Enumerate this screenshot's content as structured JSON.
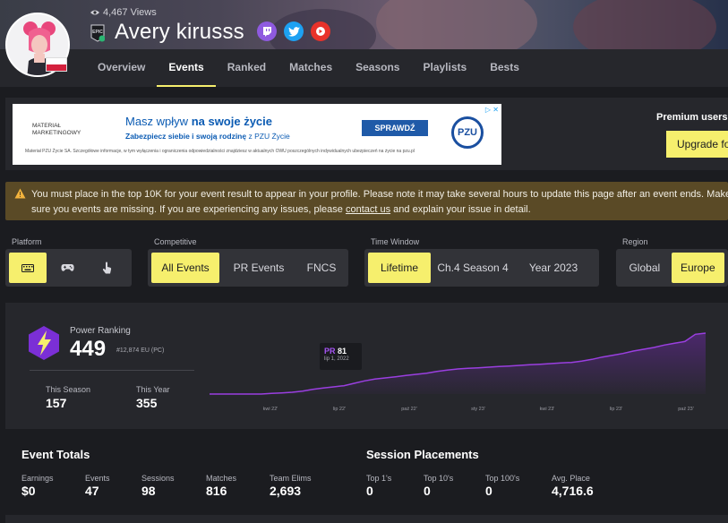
{
  "profile": {
    "views": "4,467 Views",
    "name": "Avery kirusss",
    "platform_badge": "EPIC"
  },
  "tabs": [
    {
      "label": "Overview"
    },
    {
      "label": "Events"
    },
    {
      "label": "Ranked"
    },
    {
      "label": "Matches"
    },
    {
      "label": "Seasons"
    },
    {
      "label": "Playlists"
    },
    {
      "label": "Bests"
    }
  ],
  "ad": {
    "small_label": "MATERIAŁ MARKETINGOWY",
    "headline_1": "Masz wpływ ",
    "headline_2": "na swoje życie",
    "subline_1": "Zabezpiecz siebie i swoją rodzinę",
    "subline_2": " z PZU Życie",
    "cta": "SPRAWDŹ",
    "brand": "PZU",
    "fineprint": "Materiał PZU Życie SA. Szczegółowe informacje, w tym wyłączenia i ograniczenia odpowiedzialności znajdziesz w aktualnych OWU poszczególnych indywidualnych ubezpieczeń na życie na pzu.pl"
  },
  "premium": {
    "text": "Premium users g",
    "button": "Upgrade fo"
  },
  "warning": {
    "text_before": "You must place in the top 10K for your event result to appear in your profile. Please note it may take several hours to update this page after an event ends. Make sure you events are missing. If you are experiencing any issues, please ",
    "link": "contact us",
    "text_after": " and explain your issue in detail."
  },
  "filters": {
    "platform_label": "Platform",
    "competitive_label": "Competitive",
    "competitive_options": [
      "All Events",
      "PR Events",
      "FNCS"
    ],
    "time_label": "Time Window",
    "time_options": [
      "Lifetime",
      "Ch.4 Season 4",
      "Year 2023"
    ],
    "region_label": "Region",
    "region_options": [
      "Global",
      "Europe"
    ]
  },
  "power_ranking": {
    "label": "Power Ranking",
    "value": "449",
    "sub": "#12,874 EU (PC)",
    "this_season_label": "This Season",
    "this_season_value": "157",
    "this_year_label": "This Year",
    "this_year_value": "355",
    "tooltip_prefix": "PR",
    "tooltip_value": "81",
    "tooltip_date": "lip 1, 2022"
  },
  "chart_data": {
    "type": "area",
    "x_ticks": [
      "kwi 22'",
      "lip 22'",
      "paź 22'",
      "sty 23'",
      "kwi 23'",
      "lip 23'",
      "paź 23'"
    ],
    "series": [
      {
        "values": [
          0,
          0,
          0,
          0,
          0,
          0,
          1,
          2,
          3,
          5,
          8,
          10,
          12,
          14,
          18,
          22,
          25,
          27,
          29,
          31,
          33,
          35,
          38,
          40,
          42,
          43,
          44,
          45,
          46,
          47,
          48,
          49,
          50,
          51,
          52,
          53,
          55,
          58,
          62,
          65,
          68,
          72,
          75,
          78,
          82,
          85,
          88,
          100,
          102
        ]
      }
    ],
    "color": "#9a3fe0"
  },
  "event_totals": {
    "title": "Event Totals",
    "stats": [
      {
        "label": "Earnings",
        "value": "$0"
      },
      {
        "label": "Events",
        "value": "47"
      },
      {
        "label": "Sessions",
        "value": "98"
      },
      {
        "label": "Matches",
        "value": "816"
      },
      {
        "label": "Team Elims",
        "value": "2,693"
      }
    ]
  },
  "session_placements": {
    "title": "Session Placements",
    "stats": [
      {
        "label": "Top 1's",
        "value": "0"
      },
      {
        "label": "Top 10's",
        "value": "0"
      },
      {
        "label": "Top 100's",
        "value": "0"
      },
      {
        "label": "Avg. Place",
        "value": "4,716.6"
      }
    ]
  },
  "colors": {
    "accent": "#f6ef6d",
    "background": "#1b1c20",
    "panel": "#26272c",
    "warning_bg": "#5a4a26",
    "chart_line": "#9a3fe0",
    "badge_purple": "#7b2fd6"
  }
}
